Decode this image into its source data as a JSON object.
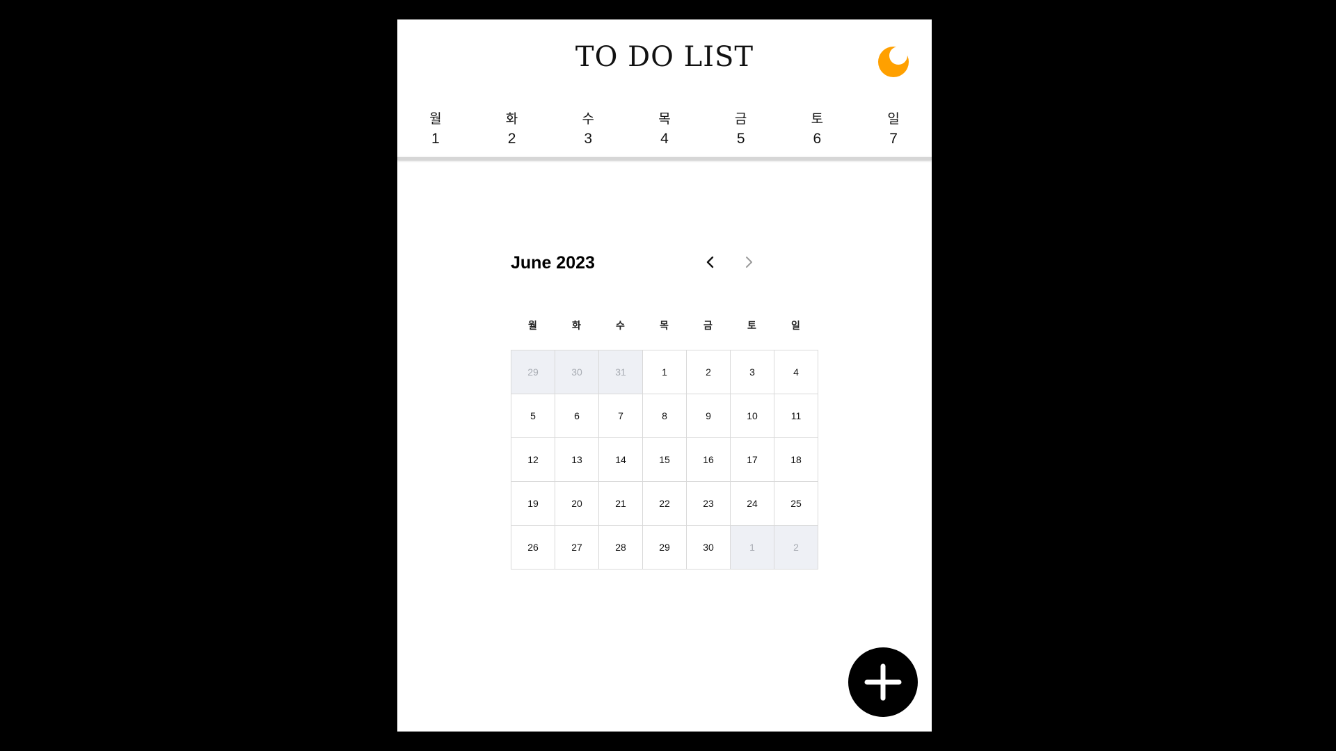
{
  "header": {
    "title": "TO DO LIST",
    "theme_icon": "moon-icon",
    "theme_color": "#FFA000"
  },
  "week_strip": [
    {
      "day": "월",
      "date": "1"
    },
    {
      "day": "화",
      "date": "2"
    },
    {
      "day": "수",
      "date": "3"
    },
    {
      "day": "목",
      "date": "4"
    },
    {
      "day": "금",
      "date": "5"
    },
    {
      "day": "토",
      "date": "6"
    },
    {
      "day": "일",
      "date": "7"
    }
  ],
  "calendar": {
    "month_label": "June 2023",
    "prev_icon": "chevron-left-icon",
    "next_icon": "chevron-right-icon",
    "weekday_headers": [
      "월",
      "화",
      "수",
      "목",
      "금",
      "토",
      "일"
    ],
    "weeks": [
      [
        {
          "d": "29",
          "muted": true
        },
        {
          "d": "30",
          "muted": true
        },
        {
          "d": "31",
          "muted": true
        },
        {
          "d": "1"
        },
        {
          "d": "2"
        },
        {
          "d": "3"
        },
        {
          "d": "4"
        }
      ],
      [
        {
          "d": "5"
        },
        {
          "d": "6"
        },
        {
          "d": "7"
        },
        {
          "d": "8"
        },
        {
          "d": "9"
        },
        {
          "d": "10"
        },
        {
          "d": "11"
        }
      ],
      [
        {
          "d": "12"
        },
        {
          "d": "13"
        },
        {
          "d": "14"
        },
        {
          "d": "15"
        },
        {
          "d": "16"
        },
        {
          "d": "17"
        },
        {
          "d": "18"
        }
      ],
      [
        {
          "d": "19"
        },
        {
          "d": "20"
        },
        {
          "d": "21"
        },
        {
          "d": "22"
        },
        {
          "d": "23"
        },
        {
          "d": "24"
        },
        {
          "d": "25"
        }
      ],
      [
        {
          "d": "26"
        },
        {
          "d": "27"
        },
        {
          "d": "28"
        },
        {
          "d": "29"
        },
        {
          "d": "30"
        },
        {
          "d": "1",
          "muted": true
        },
        {
          "d": "2",
          "muted": true
        }
      ]
    ]
  },
  "fab": {
    "icon": "plus-icon"
  },
  "colors": {
    "background": "#000000",
    "panel": "#ffffff",
    "muted_cell": "#eef0f5",
    "accent": "#FFA000"
  }
}
